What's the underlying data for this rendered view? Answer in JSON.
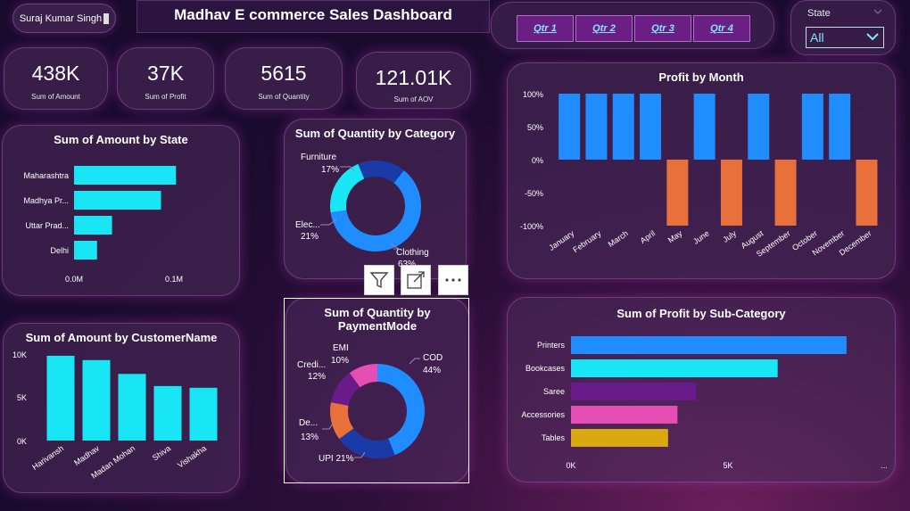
{
  "header": {
    "user_name": "Suraj Kumar Singh",
    "title": "Madhav E commerce Sales Dashboard",
    "quarters": [
      "Qtr 1",
      "Qtr 2",
      "Qtr 3",
      "Qtr 4"
    ],
    "state_filter": {
      "label": "State",
      "value": "All"
    }
  },
  "kpis": [
    {
      "value": "438K",
      "label": "Sum of Amount"
    },
    {
      "value": "37K",
      "label": "Sum of Profit"
    },
    {
      "value": "5615",
      "label": "Sum of Quantity"
    },
    {
      "value": "121.01K",
      "label": "Sum of AOV"
    }
  ],
  "visual_header": {
    "filter_icon": "filter-icon",
    "focus_icon": "focus-mode-icon",
    "more_icon": "more-options-icon"
  },
  "colors": {
    "cyan": "#19e6f5",
    "blue": "#1f8cff",
    "orange": "#e8703a",
    "purple": "#6a1b8a",
    "pink": "#e54fb4",
    "gold": "#d9a90f",
    "navy": "#1a3aa8"
  },
  "chart_data": [
    {
      "id": "amount-by-state",
      "type": "bar",
      "orientation": "horizontal",
      "title": "Sum of Amount by State",
      "categories": [
        "Maharashtra",
        "Madhya Pr...",
        "Uttar Prad...",
        "Delhi"
      ],
      "values": [
        102000,
        87000,
        38000,
        23000
      ],
      "xticks": [
        "0.0M",
        "0.1M"
      ],
      "xlim": [
        0,
        100000
      ],
      "color": "#19e6f5"
    },
    {
      "id": "quantity-by-category",
      "type": "pie",
      "donut": true,
      "title": "Sum of Quantity by Category",
      "slices": [
        {
          "name": "Clothing",
          "pct": 63,
          "label": "Clothing",
          "pct_label": "63%",
          "color": "#1f8cff"
        },
        {
          "name": "Electronics",
          "pct": 21,
          "label": "Elec...",
          "pct_label": "21%",
          "color": "#19e6f5"
        },
        {
          "name": "Furniture",
          "pct": 17,
          "label": "Furniture",
          "pct_label": "17%",
          "color": "#1a3aa8"
        }
      ]
    },
    {
      "id": "profit-by-month",
      "type": "bar",
      "title": "Profit by Month",
      "categories": [
        "January",
        "February",
        "March",
        "April",
        "May",
        "June",
        "July",
        "August",
        "September",
        "October",
        "November",
        "December"
      ],
      "values": [
        100,
        100,
        100,
        100,
        -100,
        100,
        -100,
        100,
        -100,
        100,
        100,
        -100
      ],
      "yticks": [
        "100%",
        "50%",
        "0%",
        "-50%",
        "-100%"
      ],
      "ylim": [
        -100,
        100
      ],
      "positive_color": "#1f8cff",
      "negative_color": "#e8703a"
    },
    {
      "id": "amount-by-customer",
      "type": "bar",
      "title": "Sum of Amount by CustomerName",
      "categories": [
        "Harivansh",
        "Madhav",
        "Madan Mohan",
        "Shiva",
        "Vishakha"
      ],
      "values": [
        9800,
        9300,
        7700,
        6300,
        6100
      ],
      "yticks": [
        "10K",
        "5K",
        "0K"
      ],
      "ylim": [
        0,
        10000
      ],
      "color": "#19e6f5"
    },
    {
      "id": "quantity-by-paymentmode",
      "type": "pie",
      "donut": true,
      "title_lines": [
        "Sum of Quantity by",
        "PaymentMode"
      ],
      "slices": [
        {
          "name": "COD",
          "pct": 44,
          "label": "COD",
          "pct_label": "44%",
          "color": "#1f8cff"
        },
        {
          "name": "UPI",
          "pct": 21,
          "label": "UPI 21%",
          "pct_label": "",
          "color": "#1a3aa8"
        },
        {
          "name": "Debit Card",
          "pct": 13,
          "label": "De...",
          "pct_label": "13%",
          "color": "#e8703a"
        },
        {
          "name": "Credit Card",
          "pct": 12,
          "label": "Credi...",
          "pct_label": "12%",
          "color": "#6a1b8a"
        },
        {
          "name": "EMI",
          "pct": 10,
          "label": "EMI",
          "pct_label": "10%",
          "color": "#e54fb4"
        }
      ]
    },
    {
      "id": "profit-by-subcategory",
      "type": "bar",
      "orientation": "horizontal",
      "title": "Sum of Profit by Sub-Category",
      "categories": [
        "Printers",
        "Bookcases",
        "Saree",
        "Accessories",
        "Tables"
      ],
      "values": [
        8800,
        6600,
        4000,
        3400,
        3100
      ],
      "colors": [
        "#1f8cff",
        "#19e6f5",
        "#6a1b8a",
        "#e54fb4",
        "#d9a90f"
      ],
      "xticks": [
        "0K",
        "5K",
        "..."
      ],
      "xlim": [
        0,
        10000
      ]
    }
  ]
}
